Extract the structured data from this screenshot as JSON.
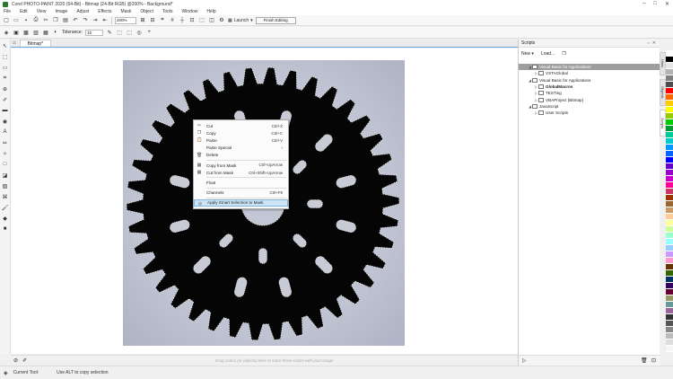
{
  "window": {
    "title": "Corel PHOTO-PAINT 2020 (64-Bit) - Bitmap (24-Bit RGB) @200% - Background*",
    "controls": [
      "–",
      "□",
      "✕"
    ]
  },
  "menu": [
    "File",
    "Edit",
    "View",
    "Image",
    "Adjust",
    "Effects",
    "Mask",
    "Object",
    "Tools",
    "Window",
    "Help"
  ],
  "toolbar": {
    "zoom": "200%",
    "launch_label": "Launch",
    "finish_label": "Finish Editing"
  },
  "propbar": {
    "tolerance_label": "Tolerance:",
    "tolerance_value": "10"
  },
  "document": {
    "tab_label": "Bitmap*"
  },
  "canvas": {
    "hint": "Drag colors (or objects) here to store these colors with your image"
  },
  "context_menu": [
    {
      "icon": "cut-icon",
      "glyph": "✂",
      "label": "Cut",
      "shortcut": "Ctrl+X",
      "disabled": false
    },
    {
      "icon": "copy-icon",
      "glyph": "❐",
      "label": "Copy",
      "shortcut": "Ctrl+C",
      "disabled": false
    },
    {
      "icon": "paste-icon",
      "glyph": "📋",
      "label": "Paste",
      "shortcut": "Ctrl+V",
      "disabled": false
    },
    {
      "icon": "",
      "glyph": "",
      "label": "Paste Special",
      "shortcut": "›",
      "disabled": false
    },
    {
      "icon": "delete-icon",
      "glyph": "🗑",
      "label": "Delete",
      "shortcut": "",
      "disabled": false
    },
    {
      "sep": true
    },
    {
      "icon": "copy-from-mask-icon",
      "glyph": "▦",
      "label": "Copy from Mask",
      "shortcut": "Ctrl+UpArrow",
      "disabled": false
    },
    {
      "icon": "cut-from-mask-icon",
      "glyph": "▦",
      "label": "Cut from Mask",
      "shortcut": "Ctrl+Shift+UpArrow",
      "disabled": false
    },
    {
      "sep": true
    },
    {
      "icon": "",
      "glyph": "",
      "label": "Float",
      "shortcut": "",
      "disabled": false
    },
    {
      "sep": true
    },
    {
      "icon": "",
      "glyph": "",
      "label": "Channels",
      "shortcut": "Ctrl+F9",
      "disabled": false
    },
    {
      "sep": true
    },
    {
      "icon": "smart-selection-icon",
      "glyph": "◎",
      "label": "Apply Smart Selection to Mask",
      "shortcut": "",
      "disabled": false,
      "highlight": true
    }
  ],
  "docker": {
    "title": "Scripts",
    "new_label": "New",
    "load_label": "Load...",
    "tree": [
      {
        "label": "Visual Basic for Applications",
        "level": 0,
        "selected": true,
        "expanded": true
      },
      {
        "label": "VSTAGlobal",
        "level": 1
      },
      {
        "label": "Visual Basic for Applications",
        "level": 0,
        "expanded": true
      },
      {
        "label": "GlobalMacros",
        "level": 1,
        "bold": true
      },
      {
        "label": "TESTing",
        "level": 1
      },
      {
        "label": "VBAProject (Bitmap)",
        "level": 1
      },
      {
        "label": "JavaScript",
        "level": 0,
        "expanded": true
      },
      {
        "label": "User Scripts",
        "level": 1
      }
    ],
    "side_tabs": [
      "Hints",
      "Objects",
      "Scripts"
    ]
  },
  "status": {
    "tool": "Current Tool:",
    "hint": "Use ALT to copy selection"
  },
  "palette": [
    "#ffffff",
    "#000000",
    "#e6e6e6",
    "#b3b3b3",
    "#7f7f7f",
    "#4d4d4d",
    "#ff0000",
    "#ff6600",
    "#ffcc00",
    "#ffff00",
    "#99cc00",
    "#00cc00",
    "#009933",
    "#00cc99",
    "#00cccc",
    "#0099ff",
    "#0066ff",
    "#0000ff",
    "#6600cc",
    "#9900cc",
    "#cc00cc",
    "#ff0099",
    "#cc3366",
    "#993300",
    "#996633",
    "#cc9966",
    "#ffcc99",
    "#ffff99",
    "#ccff99",
    "#99ffcc",
    "#99ffff",
    "#99ccff",
    "#cc99ff",
    "#ff99cc",
    "#663300",
    "#336600",
    "#003366",
    "#330066",
    "#660033",
    "#999966",
    "#669999",
    "#996699",
    "#333333",
    "#555555",
    "#888888",
    "#bbbbbb",
    "#dddddd",
    "#f5f5f5"
  ]
}
